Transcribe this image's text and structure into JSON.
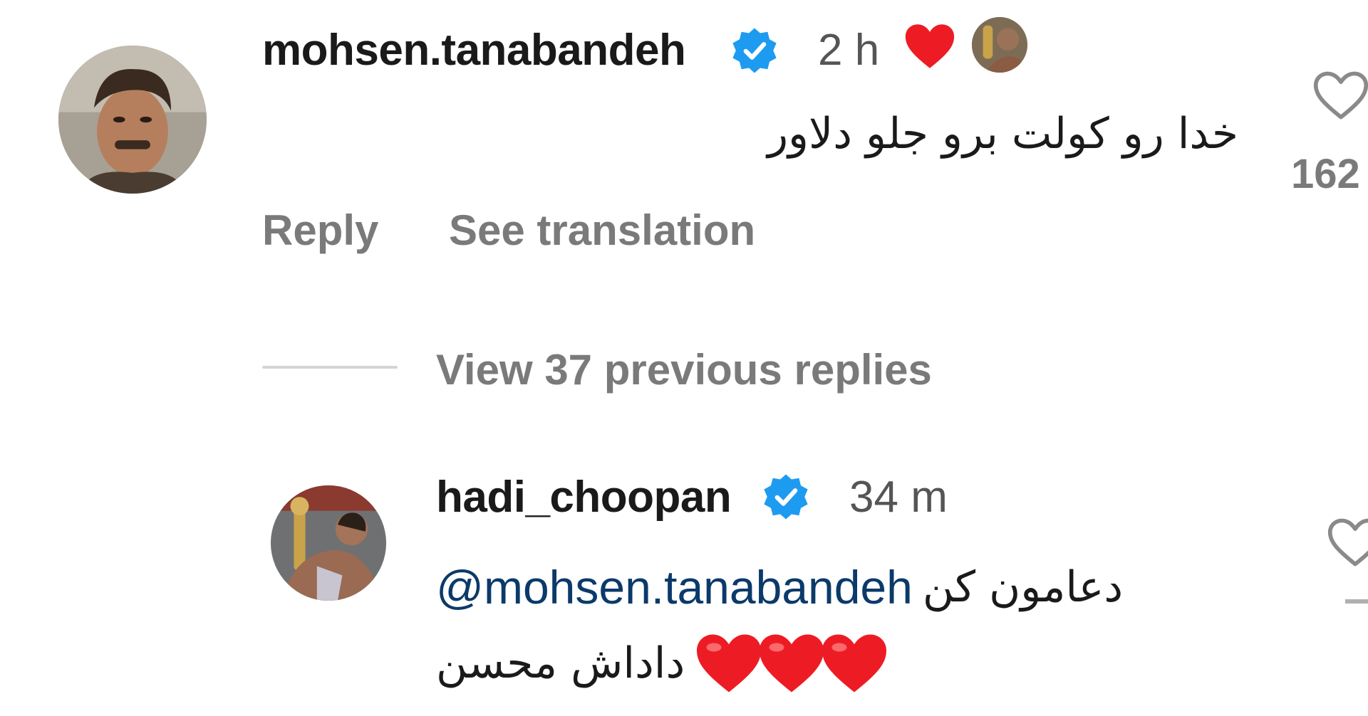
{
  "comment": {
    "username": "mohsen.tanabandeh",
    "time": "2 h",
    "text": "خدا رو کولت برو جلو دلاور",
    "like_count": "162",
    "actions": {
      "reply": "Reply",
      "see_translation": "See translation"
    }
  },
  "view_replies": "View 37 previous replies",
  "reply": {
    "username": "hadi_choopan",
    "time": "34 m",
    "mention": "@mohsen.tanabandeh",
    "text_after_mention": "دعامون کن",
    "second_line_text": "داداش محسن",
    "emoji": "❤️❤️❤️"
  },
  "colors": {
    "verified_blue": "#1d9bf0",
    "heart_red": "#ed1c24",
    "mention_blue": "#0b3a6a",
    "secondary_text": "#7a7a7a"
  }
}
